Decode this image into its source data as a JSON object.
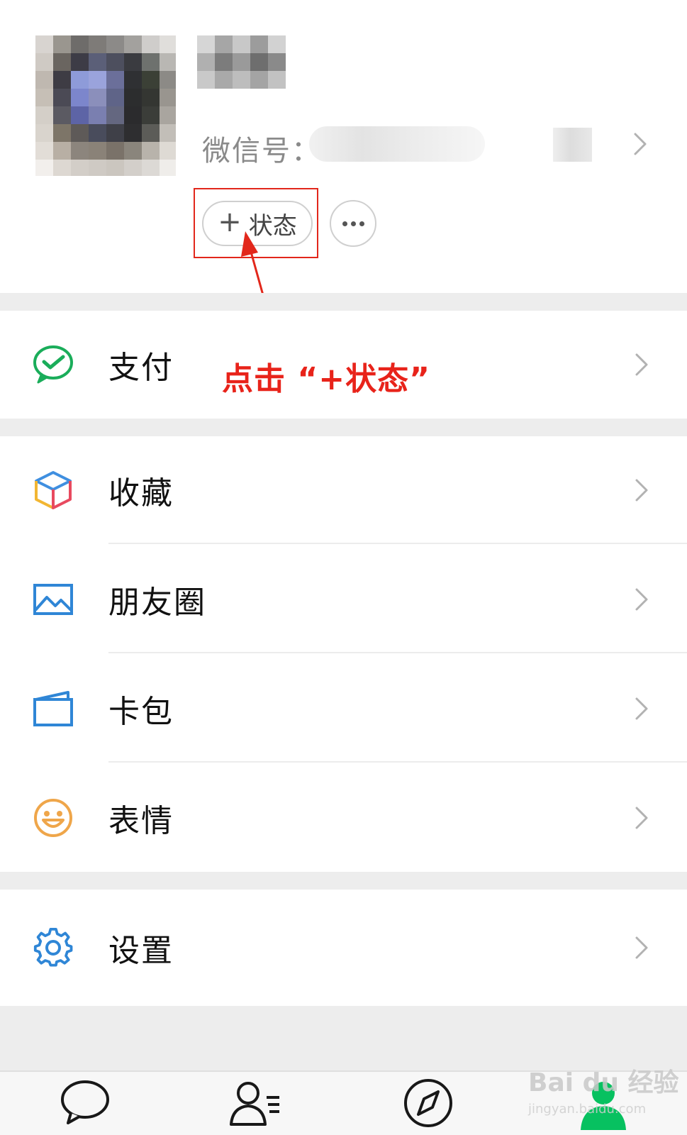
{
  "profile": {
    "wechat_id_label": "微信号：",
    "status_button": {
      "plus": "+",
      "label": "状态"
    }
  },
  "annotation": {
    "text": "点击 “+状态”",
    "color": "#e8231a"
  },
  "menu": {
    "pay": "支付",
    "favorites": "收藏",
    "moments": "朋友圈",
    "cards": "卡包",
    "stickers": "表情",
    "settings": "设置"
  },
  "tabbar": {
    "active_color": "#07c160"
  },
  "watermark": {
    "brand": "Bai du 经验",
    "url": "jingyan.baidu.com"
  }
}
